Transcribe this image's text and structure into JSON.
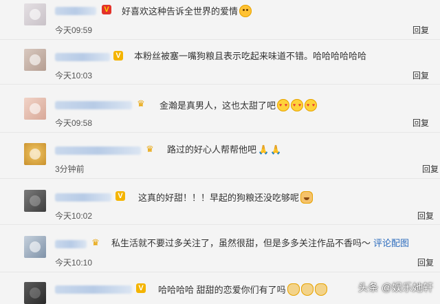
{
  "comments": [
    {
      "text": "好喜欢这种告诉全世界的爱情",
      "time": "今天09:59",
      "reply": "回复",
      "badge": "V",
      "emojis": [
        "face-emoji"
      ],
      "avatar_color": "#d9d4d8"
    },
    {
      "text": "本粉丝被塞一嘴狗粮且表示吃起来味道不错。哈哈哈哈哈哈",
      "time": "今天10:03",
      "reply": "回复",
      "badge": "V",
      "emojis": [],
      "avatar_color": "#c8b7ad"
    },
    {
      "text": "金瀚是真男人，这也太甜了吧",
      "time": "今天09:58",
      "reply": "回复",
      "badge": "crown",
      "emojis": [
        "love-emoji",
        "love-emoji",
        "love-emoji"
      ],
      "avatar_color": "#e9c6b9"
    },
    {
      "text": "路过的好心人帮帮他吧",
      "time": "3分钟前",
      "reply": "回复",
      "badge": "crown",
      "emojis": [
        "pray-emoji",
        "pray-emoji"
      ],
      "avatar_color": "#e2b24b"
    },
    {
      "text": "这真的好甜！！！早起的狗粮还没吃够呢",
      "time": "今天10:02",
      "reply": "回复",
      "badge": "V",
      "emojis": [
        "dog-emoji"
      ],
      "avatar_color": "#5a5a5a"
    },
    {
      "text": "私生活就不要过多关注了，虽然很甜，但是多多关注作品不香吗～",
      "link": "评论配图",
      "time": "今天10:10",
      "reply": "回复",
      "badge": "crown",
      "emojis": [],
      "avatar_color": "#9fb0c4"
    },
    {
      "text": "哈哈哈哈 甜甜的恋爱你们有了吗",
      "time": "",
      "reply": "",
      "badge": "V",
      "emojis": [
        "doge-emoji",
        "doge-emoji",
        "doge-emoji"
      ],
      "avatar_color": "#444444"
    }
  ],
  "watermark": "头条 @娱乐她轩"
}
